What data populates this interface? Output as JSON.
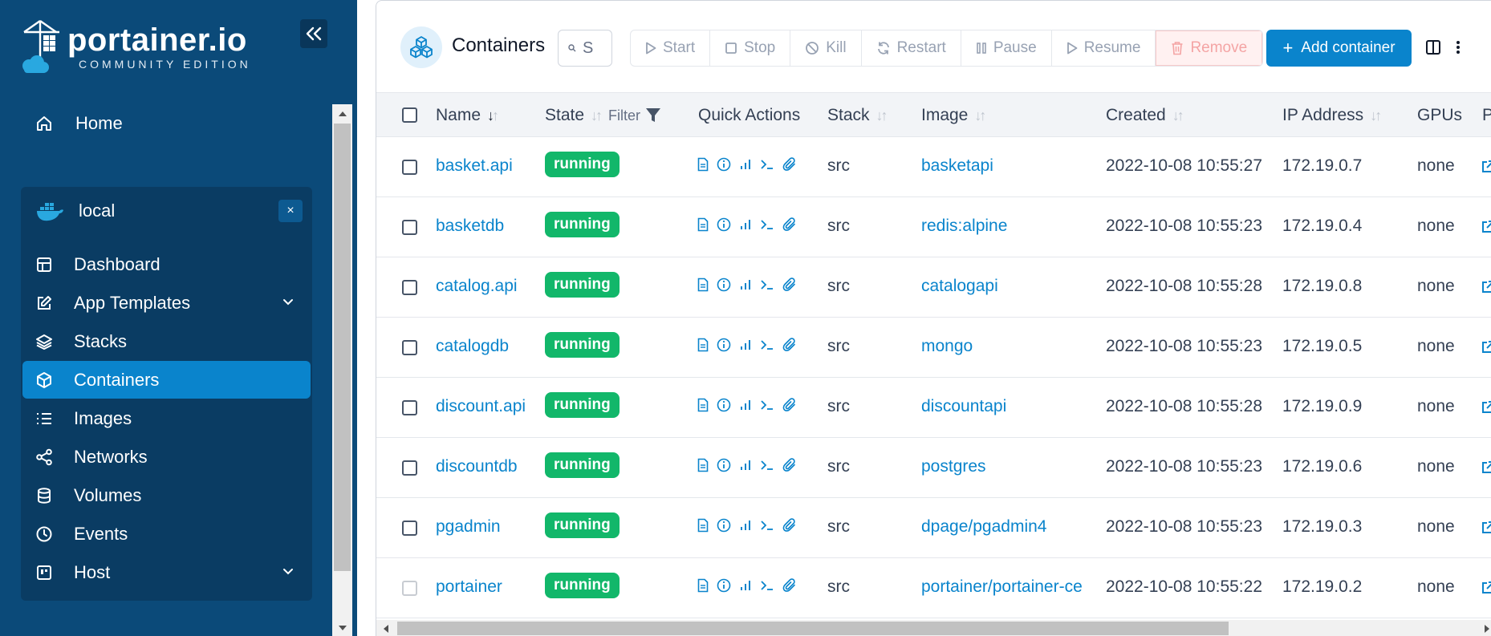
{
  "brand": {
    "name": "portainer.io",
    "edition": "COMMUNITY EDITION"
  },
  "sidebar": {
    "home_label": "Home",
    "environment": {
      "name": "local",
      "close_label": "×"
    },
    "items": [
      {
        "label": "Dashboard",
        "icon": "dashboard-icon",
        "active": false,
        "expandable": false
      },
      {
        "label": "App Templates",
        "icon": "edit-icon",
        "active": false,
        "expandable": true
      },
      {
        "label": "Stacks",
        "icon": "layers-icon",
        "active": false,
        "expandable": false
      },
      {
        "label": "Containers",
        "icon": "box-icon",
        "active": true,
        "expandable": false
      },
      {
        "label": "Images",
        "icon": "list-icon",
        "active": false,
        "expandable": false
      },
      {
        "label": "Networks",
        "icon": "share-icon",
        "active": false,
        "expandable": false
      },
      {
        "label": "Volumes",
        "icon": "database-icon",
        "active": false,
        "expandable": false
      },
      {
        "label": "Events",
        "icon": "clock-icon",
        "active": false,
        "expandable": false
      },
      {
        "label": "Host",
        "icon": "server-icon",
        "active": false,
        "expandable": true
      }
    ]
  },
  "toolbar": {
    "title": "Containers",
    "search_value": "S",
    "actions": {
      "start": "Start",
      "stop": "Stop",
      "kill": "Kill",
      "restart": "Restart",
      "pause": "Pause",
      "resume": "Resume",
      "remove": "Remove"
    },
    "add_label": "Add container"
  },
  "table": {
    "columns": {
      "name": "Name",
      "state": "State",
      "filter": "Filter",
      "quick_actions": "Quick Actions",
      "stack": "Stack",
      "image": "Image",
      "created": "Created",
      "ip": "IP Address",
      "gpus": "GPUs",
      "ports": "P"
    },
    "rows": [
      {
        "name": "basket.api",
        "state": "running",
        "stack": "src",
        "image": "basketapi",
        "created": "2022-10-08 10:55:27",
        "ip": "172.19.0.7",
        "gpus": "none"
      },
      {
        "name": "basketdb",
        "state": "running",
        "stack": "src",
        "image": "redis:alpine",
        "created": "2022-10-08 10:55:23",
        "ip": "172.19.0.4",
        "gpus": "none"
      },
      {
        "name": "catalog.api",
        "state": "running",
        "stack": "src",
        "image": "catalogapi",
        "created": "2022-10-08 10:55:28",
        "ip": "172.19.0.8",
        "gpus": "none"
      },
      {
        "name": "catalogdb",
        "state": "running",
        "stack": "src",
        "image": "mongo",
        "created": "2022-10-08 10:55:23",
        "ip": "172.19.0.5",
        "gpus": "none"
      },
      {
        "name": "discount.api",
        "state": "running",
        "stack": "src",
        "image": "discountapi",
        "created": "2022-10-08 10:55:28",
        "ip": "172.19.0.9",
        "gpus": "none"
      },
      {
        "name": "discountdb",
        "state": "running",
        "stack": "src",
        "image": "postgres",
        "created": "2022-10-08 10:55:23",
        "ip": "172.19.0.6",
        "gpus": "none"
      },
      {
        "name": "pgadmin",
        "state": "running",
        "stack": "src",
        "image": "dpage/pgadmin4",
        "created": "2022-10-08 10:55:23",
        "ip": "172.19.0.3",
        "gpus": "none"
      },
      {
        "name": "portainer",
        "state": "running",
        "stack": "src",
        "image": "portainer/portainer-ce",
        "created": "2022-10-08 10:55:22",
        "ip": "172.19.0.2",
        "gpus": "none"
      }
    ]
  },
  "colors": {
    "sidebar_bg": "#0b4a79",
    "accent": "#0a84cc",
    "running": "#12b76a"
  }
}
